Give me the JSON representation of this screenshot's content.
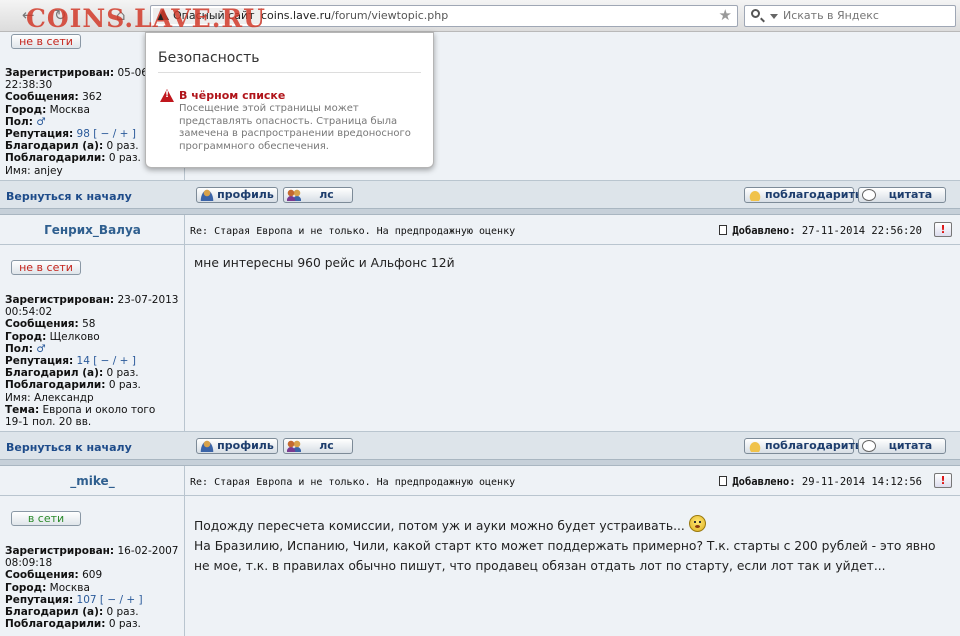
{
  "browser": {
    "watermark": "COINS.LAVE.RU",
    "site_identity": "Опасный сайт",
    "url_domain": "coins.lave.ru",
    "url_path": "/forum/viewtopic.php",
    "search_placeholder": "Искать в Яндекс"
  },
  "security_popup": {
    "title": "Безопасность",
    "heading": "В чёрном списке",
    "body": "Посещение этой страницы может представлять опасность. Страница была замечена в распространении вредоносного программного обеспечения."
  },
  "labels": {
    "back_to_top": "Вернуться к началу",
    "profile": "профиль",
    "pm": "лс",
    "thank": "поблагодарить",
    "quote": "цитата",
    "added": "Добавлено:",
    "offline": "не в сети",
    "online": "в сети",
    "registered": "Зарегистрирован:",
    "messages": "Сообщения:",
    "city": "Город:",
    "gender": "Пол:",
    "reputation": "Репутация:",
    "thanked": "Благодарил (а):",
    "thanked_by": "Поблагодарили:",
    "name": "Имя:",
    "topic": "Тема:",
    "report": "!"
  },
  "posts": [
    {
      "status": "не в сети",
      "registered_1": "05-06",
      "registered_2": "22:38:30",
      "messages": "362",
      "city": "Москва",
      "gender_icon": "male-icon",
      "reputation": "98",
      "rep_controls": "[ − / + ]",
      "thanked": "0 раз.",
      "thanked_by": "0 раз.",
      "name": "anjey"
    },
    {
      "author": "Генрих_Валуа",
      "subject": "Re: Старая Европа и не только. На предпродажную оценку",
      "added": "27-11-2014 22:56:20",
      "status": "не в сети",
      "registered_1": "23-07-2013",
      "registered_2": "00:54:02",
      "messages": "58",
      "city": "Щелково",
      "gender_icon": "male-icon",
      "reputation": "14",
      "rep_controls": "[ − / + ]",
      "thanked": "0 раз.",
      "thanked_by": "0 раз.",
      "name": "Александр",
      "topic_1": "Европа и около того",
      "topic_2": "19-1 пол. 20 вв.",
      "message": "мне интересны 960 рейс и Альфонс 12й"
    },
    {
      "author": "_mike_",
      "subject": "Re: Старая Европа и не только. На предпродажную оценку",
      "added": "29-11-2014 14:12:56",
      "status": "в сети",
      "registered_1": "16-02-2007",
      "registered_2": "08:09:18",
      "messages": "609",
      "city": "Москва",
      "reputation": "107",
      "rep_controls": "[ − / + ]",
      "thanked": "0 раз.",
      "thanked_by": "0 раз.",
      "message_line1": "Подожду пересчета комиссии, потом уж и ауки можно будет устраивать...",
      "message_line2": "На Бразилию, Испанию, Чили, какой старт кто может поддержать примерно? Т.к. старты с 200 рублей - это явно",
      "message_line3": "не мое, т.к. в правилах обычно пишут, что продавец обязан отдать лот по старту, если лот так и уйдет..."
    }
  ]
}
